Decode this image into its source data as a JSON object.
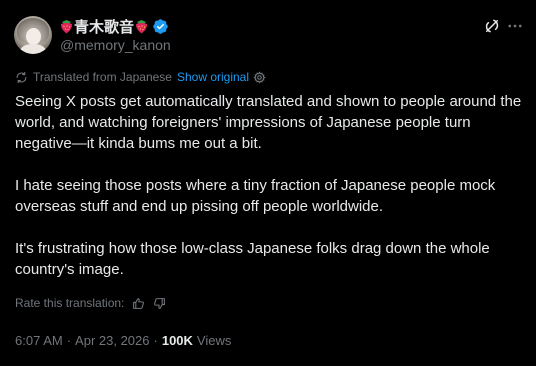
{
  "author": {
    "display_name": "青木歌音",
    "handle": "@memory_kanon",
    "verified": true
  },
  "translation": {
    "label": "Translated from Japanese",
    "show_original": "Show original"
  },
  "tweet": {
    "paragraphs": [
      "Seeing X posts get automatically translated and shown to people around the world, and watching foreigners' impressions of Japanese people turn negative—it kinda bums me out a bit.",
      "I hate seeing those posts where a tiny fraction of Japanese people mock overseas stuff and end up pissing off people worldwide.",
      "It's frustrating how those low-class Japanese folks drag down the whole country's image."
    ]
  },
  "rate": {
    "label": "Rate this translation:"
  },
  "meta": {
    "time": "6:07 AM",
    "separator": "·",
    "date": "Apr 23, 2026",
    "views_count": "100K",
    "views_label": "Views"
  },
  "icons": {
    "emoji": "strawberry",
    "verified": "verified-badge-icon",
    "grok": "grok-icon",
    "more": "more-icon",
    "translate": "translate-icon",
    "settings": "gear-icon",
    "thumbs_up": "thumbs-up-icon",
    "thumbs_down": "thumbs-down-icon"
  },
  "colors": {
    "background": "#000000",
    "text": "#e7e9ea",
    "secondary": "#71767b",
    "accent": "#1d9bf0",
    "strawberry": "#e0245e"
  }
}
